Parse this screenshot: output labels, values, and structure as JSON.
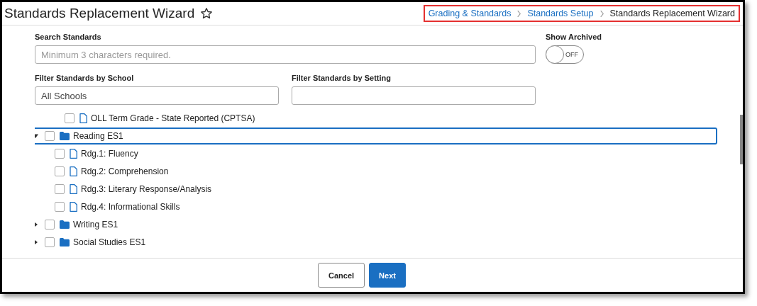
{
  "page": {
    "title": "Standards Replacement Wizard",
    "favorite": false
  },
  "breadcrumbs": [
    {
      "label": "Grading & Standards",
      "link": true
    },
    {
      "label": "Standards Setup",
      "link": true
    },
    {
      "label": "Standards Replacement Wizard",
      "link": false
    }
  ],
  "search": {
    "label": "Search Standards",
    "placeholder": "Minimum 3 characters required."
  },
  "show_archived": {
    "label": "Show Archived",
    "on": false,
    "state_text": "OFF"
  },
  "school_filter": {
    "label": "Filter Standards by School",
    "value": "All Schools"
  },
  "setting_filter": {
    "label": "Filter Standards by Setting"
  },
  "tree": [
    {
      "kind": "continued",
      "children": [
        {
          "kind": "continued",
          "children": [
            {
              "kind": "standard",
              "label": "OLL Term Grade - State Reported (CPTSA)",
              "checked": false,
              "selected": false
            }
          ]
        }
      ]
    },
    {
      "kind": "folder",
      "label": "Reading ES1",
      "checked": false,
      "selected": true,
      "expanded": true,
      "children": [
        {
          "kind": "standard",
          "label": "Rdg.1: Fluency",
          "checked": false,
          "selected": false
        },
        {
          "kind": "standard",
          "label": "Rdg.2: Comprehension",
          "checked": false,
          "selected": false
        },
        {
          "kind": "standard",
          "label": "Rdg.3: Literary Response/Analysis",
          "checked": false,
          "selected": false
        },
        {
          "kind": "standard",
          "label": "Rdg.4: Informational Skills",
          "checked": false,
          "selected": false
        }
      ]
    },
    {
      "kind": "folder",
      "label": "Writing ES1",
      "checked": false,
      "selected": false,
      "expanded": false
    },
    {
      "kind": "folder",
      "label": "Social Studies ES1",
      "checked": false,
      "selected": false,
      "expanded": false
    }
  ],
  "buttons": [
    {
      "label": "Cancel",
      "kind": "secondary"
    },
    {
      "label": "Next",
      "kind": "primary"
    }
  ]
}
